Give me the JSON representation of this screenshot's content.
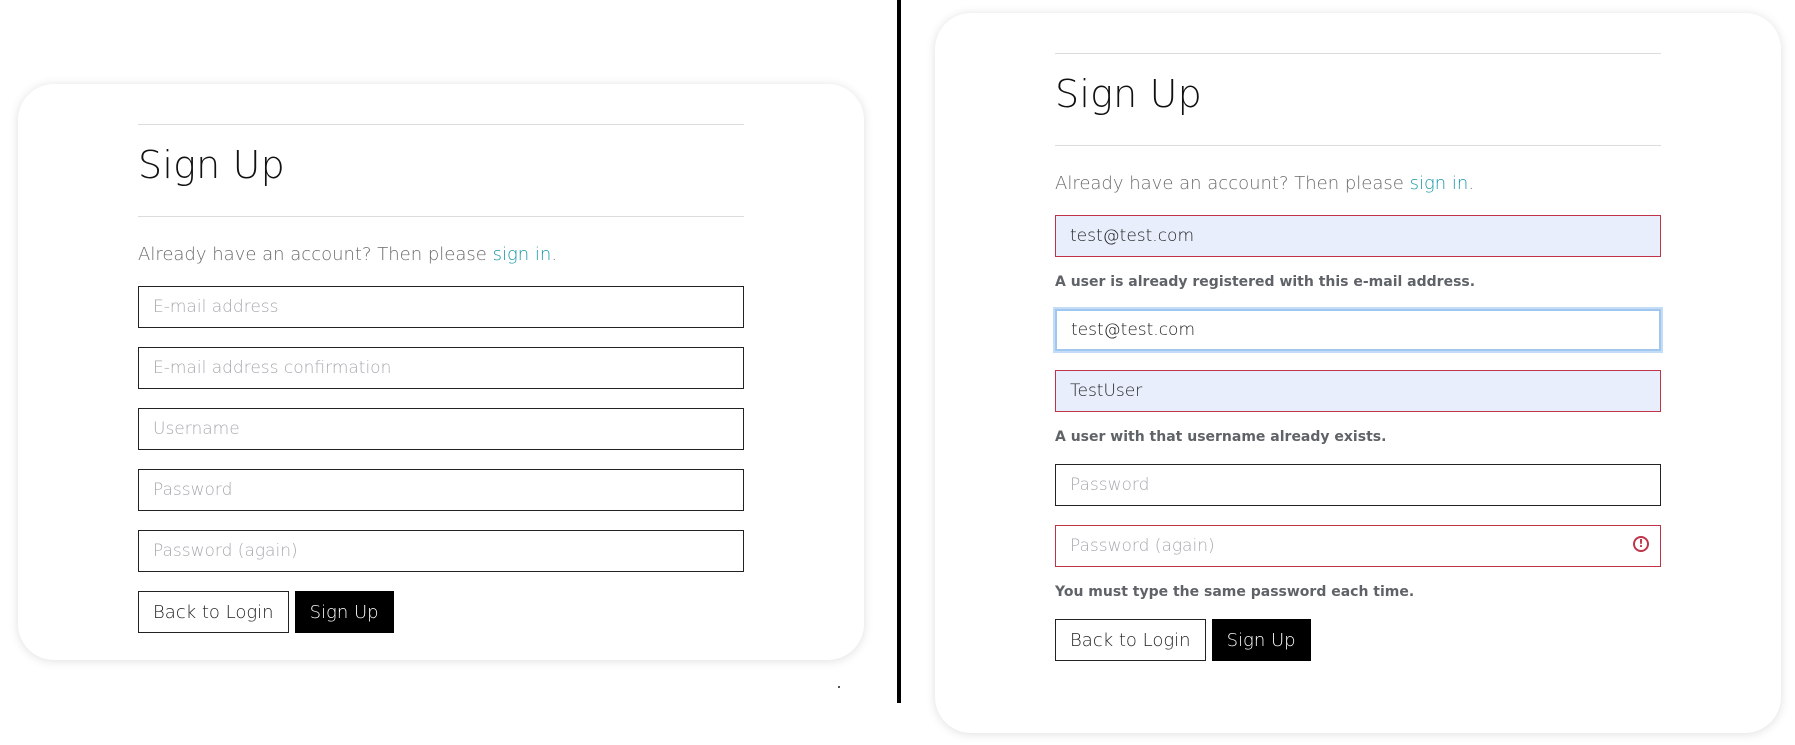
{
  "left_form": {
    "title": "Sign Up",
    "hint_prefix": "Already have an account? Then please ",
    "hint_link": "sign in",
    "hint_suffix": ".",
    "email_placeholder": "E-mail address",
    "email_confirm_placeholder": "E-mail address confirmation",
    "username_placeholder": "Username",
    "password_placeholder": "Password",
    "password_again_placeholder": "Password (again)",
    "back_label": "Back to Login",
    "submit_label": "Sign Up"
  },
  "right_form": {
    "title": "Sign Up",
    "hint_prefix": "Already have an account? Then please ",
    "hint_link": "sign in",
    "hint_suffix": ".",
    "email_value": "test@test.com",
    "email_error": "A user is already registered with this e-mail address.",
    "email_confirm_value": "test@test.com",
    "username_value": "TestUser",
    "username_error": "A user with that username already exists.",
    "password_placeholder": "Password",
    "password_again_placeholder": "Password (again)",
    "password_error": "You must type the same password each time.",
    "back_label": "Back to Login",
    "submit_label": "Sign Up"
  },
  "colors": {
    "link": "#1a97a8",
    "error_border": "#c0344a",
    "autofill_background": "#e8eefc",
    "focus_ring": "#9fc7f0"
  },
  "icons": {
    "password_mismatch": "alert-circle-icon"
  }
}
